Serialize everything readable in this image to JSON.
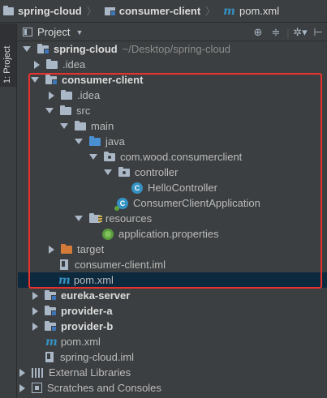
{
  "breadcrumb": {
    "items": [
      {
        "label": "spring-cloud",
        "icon": "folder-icon"
      },
      {
        "label": "consumer-client",
        "icon": "module-folder-icon"
      },
      {
        "label": "pom.xml",
        "icon": "maven-icon"
      }
    ],
    "maven_glyph": "m",
    "separator": "〉"
  },
  "side_stripe": {
    "label": "1: Project"
  },
  "panel": {
    "title": "Project",
    "dropdown_glyph": "▼",
    "tools": {
      "target": "⊕",
      "collapse": "≑",
      "settings": "✲▾",
      "hide": "⊢"
    }
  },
  "tree": [
    {
      "label": "spring-cloud",
      "path": "~/Desktop/spring-cloud"
    },
    {
      "label": ".idea"
    },
    {
      "label": "consumer-client"
    },
    {
      "label": ".idea"
    },
    {
      "label": "src"
    },
    {
      "label": "main"
    },
    {
      "label": "java"
    },
    {
      "label": "com.wood.consumerclient"
    },
    {
      "label": "controller"
    },
    {
      "label": "HelloController",
      "glyph": "C"
    },
    {
      "label": "ConsumerClientApplication",
      "glyph": "C"
    },
    {
      "label": "resources"
    },
    {
      "label": "application.properties"
    },
    {
      "label": "target"
    },
    {
      "label": "consumer-client.iml"
    },
    {
      "label": "pom.xml",
      "glyph": "m"
    },
    {
      "label": "eureka-server"
    },
    {
      "label": "provider-a"
    },
    {
      "label": "provider-b"
    },
    {
      "label": "pom.xml",
      "glyph": "m"
    },
    {
      "label": "spring-cloud.iml"
    },
    {
      "label": "External Libraries"
    },
    {
      "label": "Scratches and Consoles"
    }
  ],
  "colors": {
    "background": "#3c3f41",
    "selection": "#0d293e",
    "highlight_box": "#e8322e",
    "maven_blue": "#3592c4",
    "source_folder_blue": "#4a8fd1",
    "excluded_folder_orange": "#d47b39"
  }
}
